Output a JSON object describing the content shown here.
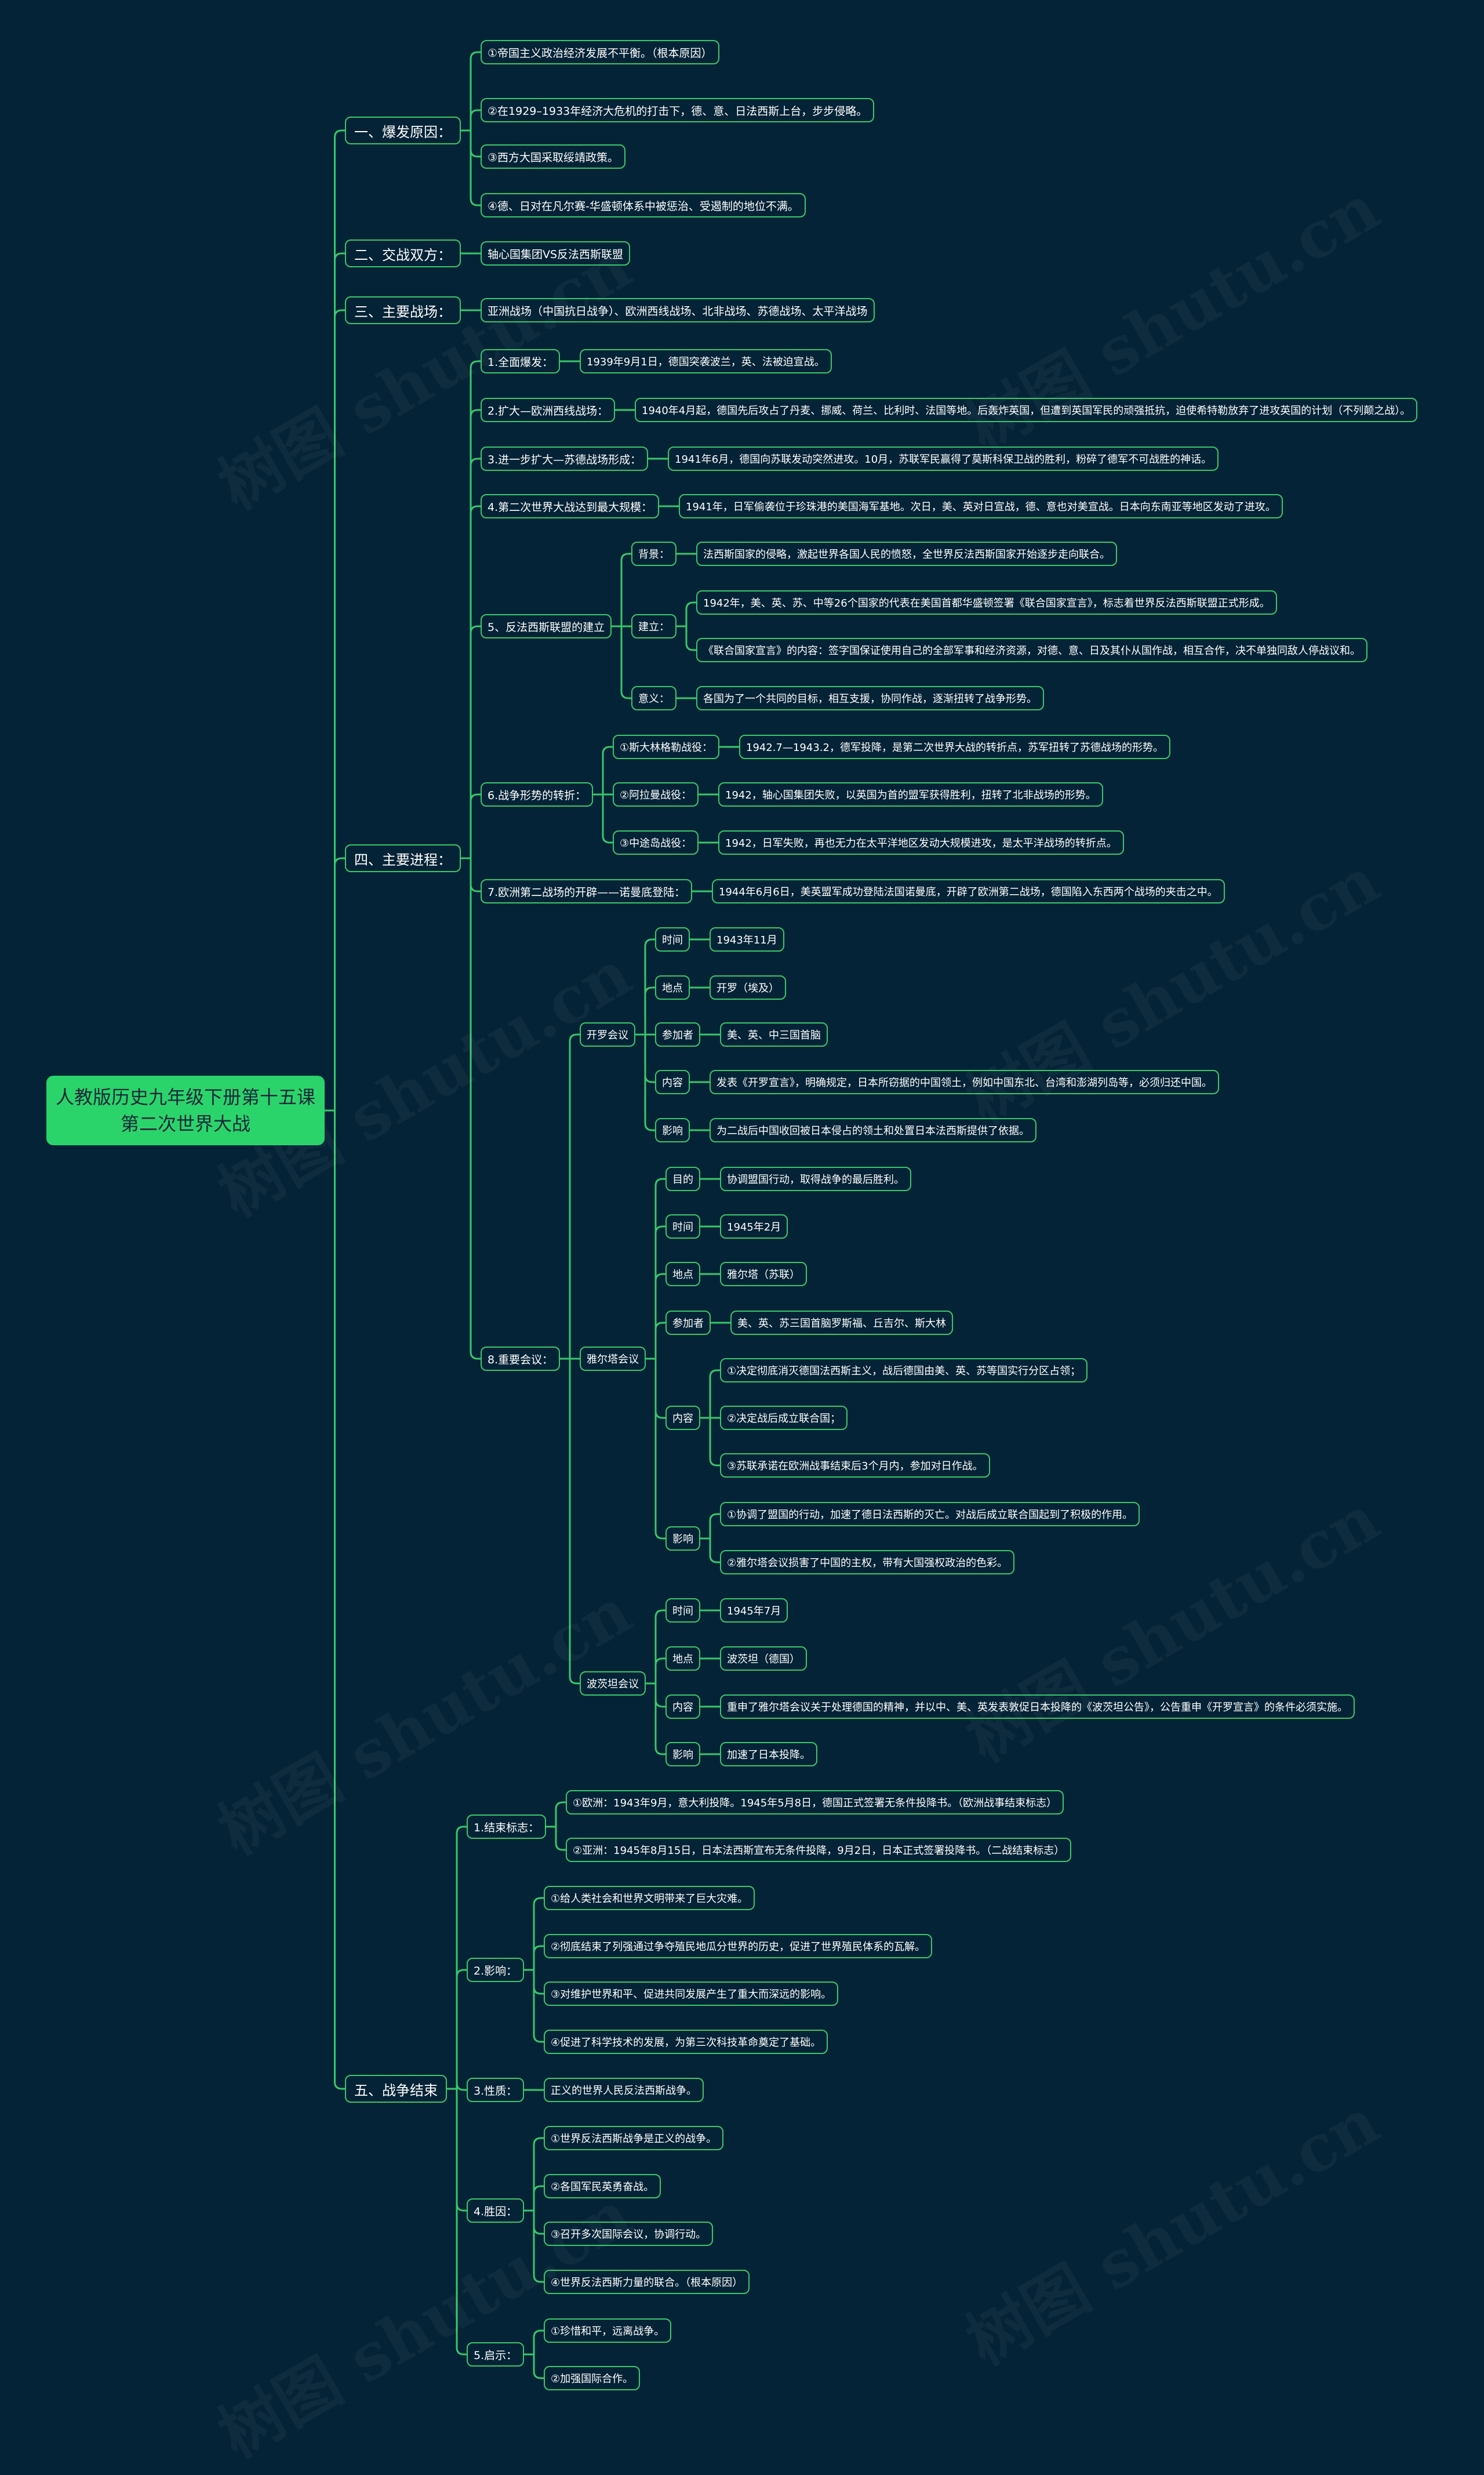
{
  "root": "人教版历史九年级下册第十五课第二次世界大战",
  "watermark": "树图 shutu.cn",
  "line_color": "#38c86a",
  "root_color": "#2bd46a",
  "background_color": "#052336",
  "tree": [
    {
      "text": "一、爆发原因：",
      "children": [
        {
          "text": "①帝国主义政治经济发展不平衡。（根本原因）"
        },
        {
          "text": "②在1929–1933年经济大危机的打击下，德、意、日法西斯上台，步步侵略。"
        },
        {
          "text": "③西方大国采取绥靖政策。"
        },
        {
          "text": "④德、日对在凡尔赛-华盛顿体系中被惩治、受遏制的地位不满。"
        }
      ]
    },
    {
      "text": "二、交战双方：",
      "children": [
        {
          "text": "轴心国集团VS反法西斯联盟"
        }
      ]
    },
    {
      "text": "三、主要战场：",
      "children": [
        {
          "text": "亚洲战场（中国抗日战争）、欧洲西线战场、北非战场、苏德战场、太平洋战场"
        }
      ]
    },
    {
      "text": "四、主要进程：",
      "children": [
        {
          "text": "1.全面爆发：",
          "children": [
            {
              "text": "1939年9月1日，德国突袭波兰，英、法被迫宣战。"
            }
          ]
        },
        {
          "text": "2.扩大—欧洲西线战场：",
          "children": [
            {
              "text": "1940年4月起，德国先后攻占了丹麦、挪威、荷兰、比利时、法国等地。后轰炸英国，但遭到英国军民的顽强抵抗，迫使希特勒放弃了进攻英国的计划（不列颠之战）。"
            }
          ]
        },
        {
          "text": "3.进一步扩大—苏德战场形成：",
          "children": [
            {
              "text": "1941年6月，德国向苏联发动突然进攻。10月，苏联军民赢得了莫斯科保卫战的胜利，粉碎了德军不可战胜的神话。"
            }
          ]
        },
        {
          "text": "4.第二次世界大战达到最大规模：",
          "children": [
            {
              "text": "1941年，日军偷袭位于珍珠港的美国海军基地。次日，美、英对日宣战，德、意也对美宣战。日本向东南亚等地区发动了进攻。"
            }
          ]
        },
        {
          "text": "5、反法西斯联盟的建立",
          "children": [
            {
              "text": "背景：",
              "children": [
                {
                  "text": "法西斯国家的侵略，激起世界各国人民的愤怒，全世界反法西斯国家开始逐步走向联合。"
                }
              ]
            },
            {
              "text": "建立：",
              "children": [
                {
                  "text": "1942年，美、英、苏、中等26个国家的代表在美国首都华盛顿签署《联合国家宣言》，标志着世界反法西斯联盟正式形成。"
                },
                {
                  "text": "《联合国家宣言》的内容：签字国保证使用自己的全部军事和经济资源，对德、意、日及其仆从国作战，相互合作，决不单独同敌人停战议和。"
                }
              ]
            },
            {
              "text": "意义：",
              "children": [
                {
                  "text": "各国为了一个共同的目标，相互支援，协同作战，逐渐扭转了战争形势。"
                }
              ]
            }
          ]
        },
        {
          "text": "6.战争形势的转折：",
          "children": [
            {
              "text": "①斯大林格勒战役：",
              "children": [
                {
                  "text": "1942.7—1943.2，德军投降，是第二次世界大战的转折点，苏军扭转了苏德战场的形势。"
                }
              ]
            },
            {
              "text": "②阿拉曼战役：",
              "children": [
                {
                  "text": "1942，轴心国集团失败，以英国为首的盟军获得胜利，扭转了北非战场的形势。"
                }
              ]
            },
            {
              "text": "③中途岛战役：",
              "children": [
                {
                  "text": "1942，日军失败，再也无力在太平洋地区发动大规模进攻，是太平洋战场的转折点。"
                }
              ]
            }
          ]
        },
        {
          "text": "7.欧洲第二战场的开辟——诺曼底登陆：",
          "children": [
            {
              "text": "1944年6月6日，美英盟军成功登陆法国诺曼底，开辟了欧洲第二战场，德国陷入东西两个战场的夹击之中。"
            }
          ]
        },
        {
          "text": "8.重要会议：",
          "children": [
            {
              "text": "开罗会议",
              "children": [
                {
                  "text": "时间",
                  "children": [
                    {
                      "text": "1943年11月"
                    }
                  ]
                },
                {
                  "text": "地点",
                  "children": [
                    {
                      "text": "开罗（埃及）"
                    }
                  ]
                },
                {
                  "text": "参加者",
                  "children": [
                    {
                      "text": "美、英、中三国首脑"
                    }
                  ]
                },
                {
                  "text": "内容",
                  "children": [
                    {
                      "text": "发表《开罗宣言》，明确规定，日本所窃据的中国领土，例如中国东北、台湾和澎湖列岛等，必须归还中国。"
                    }
                  ]
                },
                {
                  "text": "影响",
                  "children": [
                    {
                      "text": "为二战后中国收回被日本侵占的领土和处置日本法西斯提供了依据。"
                    }
                  ]
                }
              ]
            },
            {
              "text": "雅尔塔会议",
              "children": [
                {
                  "text": "目的",
                  "children": [
                    {
                      "text": "协调盟国行动，取得战争的最后胜利。"
                    }
                  ]
                },
                {
                  "text": "时间",
                  "children": [
                    {
                      "text": "1945年2月"
                    }
                  ]
                },
                {
                  "text": "地点",
                  "children": [
                    {
                      "text": "雅尔塔（苏联）"
                    }
                  ]
                },
                {
                  "text": "参加者",
                  "children": [
                    {
                      "text": "美、英、苏三国首脑罗斯福、丘吉尔、斯大林"
                    }
                  ]
                },
                {
                  "text": "内容",
                  "children": [
                    {
                      "text": "①决定彻底消灭德国法西斯主义，战后德国由美、英、苏等国实行分区占领；"
                    },
                    {
                      "text": "②决定战后成立联合国；"
                    },
                    {
                      "text": "③苏联承诺在欧洲战事结束后3个月内，参加对日作战。"
                    }
                  ]
                },
                {
                  "text": "影响",
                  "children": [
                    {
                      "text": "①协调了盟国的行动，加速了德日法西斯的灭亡。对战后成立联合国起到了积极的作用。"
                    },
                    {
                      "text": "②雅尔塔会议损害了中国的主权，带有大国强权政治的色彩。"
                    }
                  ]
                }
              ]
            },
            {
              "text": "波茨坦会议",
              "children": [
                {
                  "text": "时间",
                  "children": [
                    {
                      "text": "1945年7月"
                    }
                  ]
                },
                {
                  "text": "地点",
                  "children": [
                    {
                      "text": "波茨坦（德国）"
                    }
                  ]
                },
                {
                  "text": "内容",
                  "children": [
                    {
                      "text": "重申了雅尔塔会议关于处理德国的精神，并以中、美、英发表敦促日本投降的《波茨坦公告》，公告重申《开罗宣言》的条件必须实施。"
                    }
                  ]
                },
                {
                  "text": "影响",
                  "children": [
                    {
                      "text": "加速了日本投降。"
                    }
                  ]
                }
              ]
            }
          ]
        }
      ]
    },
    {
      "text": "五、战争结束",
      "children": [
        {
          "text": "1.结束标志：",
          "children": [
            {
              "text": "①欧洲：1943年9月，意大利投降。1945年5月8日，德国正式签署无条件投降书。（欧洲战事结束标志）"
            },
            {
              "text": "②亚洲：1945年8月15日，日本法西斯宣布无条件投降，9月2日，日本正式签署投降书。（二战结束标志）"
            }
          ]
        },
        {
          "text": "2.影响：",
          "children": [
            {
              "text": "①给人类社会和世界文明带来了巨大灾难。"
            },
            {
              "text": "②彻底结束了列强通过争夺殖民地瓜分世界的历史，促进了世界殖民体系的瓦解。"
            },
            {
              "text": "③对维护世界和平、促进共同发展产生了重大而深远的影响。"
            },
            {
              "text": "④促进了科学技术的发展，为第三次科技革命奠定了基础。"
            }
          ]
        },
        {
          "text": "3.性质：",
          "children": [
            {
              "text": "正义的世界人民反法西斯战争。"
            }
          ]
        },
        {
          "text": "4.胜因：",
          "children": [
            {
              "text": "①世界反法西斯战争是正义的战争。"
            },
            {
              "text": "②各国军民英勇奋战。"
            },
            {
              "text": "③召开多次国际会议，协调行动。"
            },
            {
              "text": "④世界反法西斯力量的联合。（根本原因）"
            }
          ]
        },
        {
          "text": "5.启示：",
          "children": [
            {
              "text": "①珍惜和平，远离战争。"
            },
            {
              "text": "②加强国际合作。"
            }
          ]
        }
      ]
    }
  ]
}
